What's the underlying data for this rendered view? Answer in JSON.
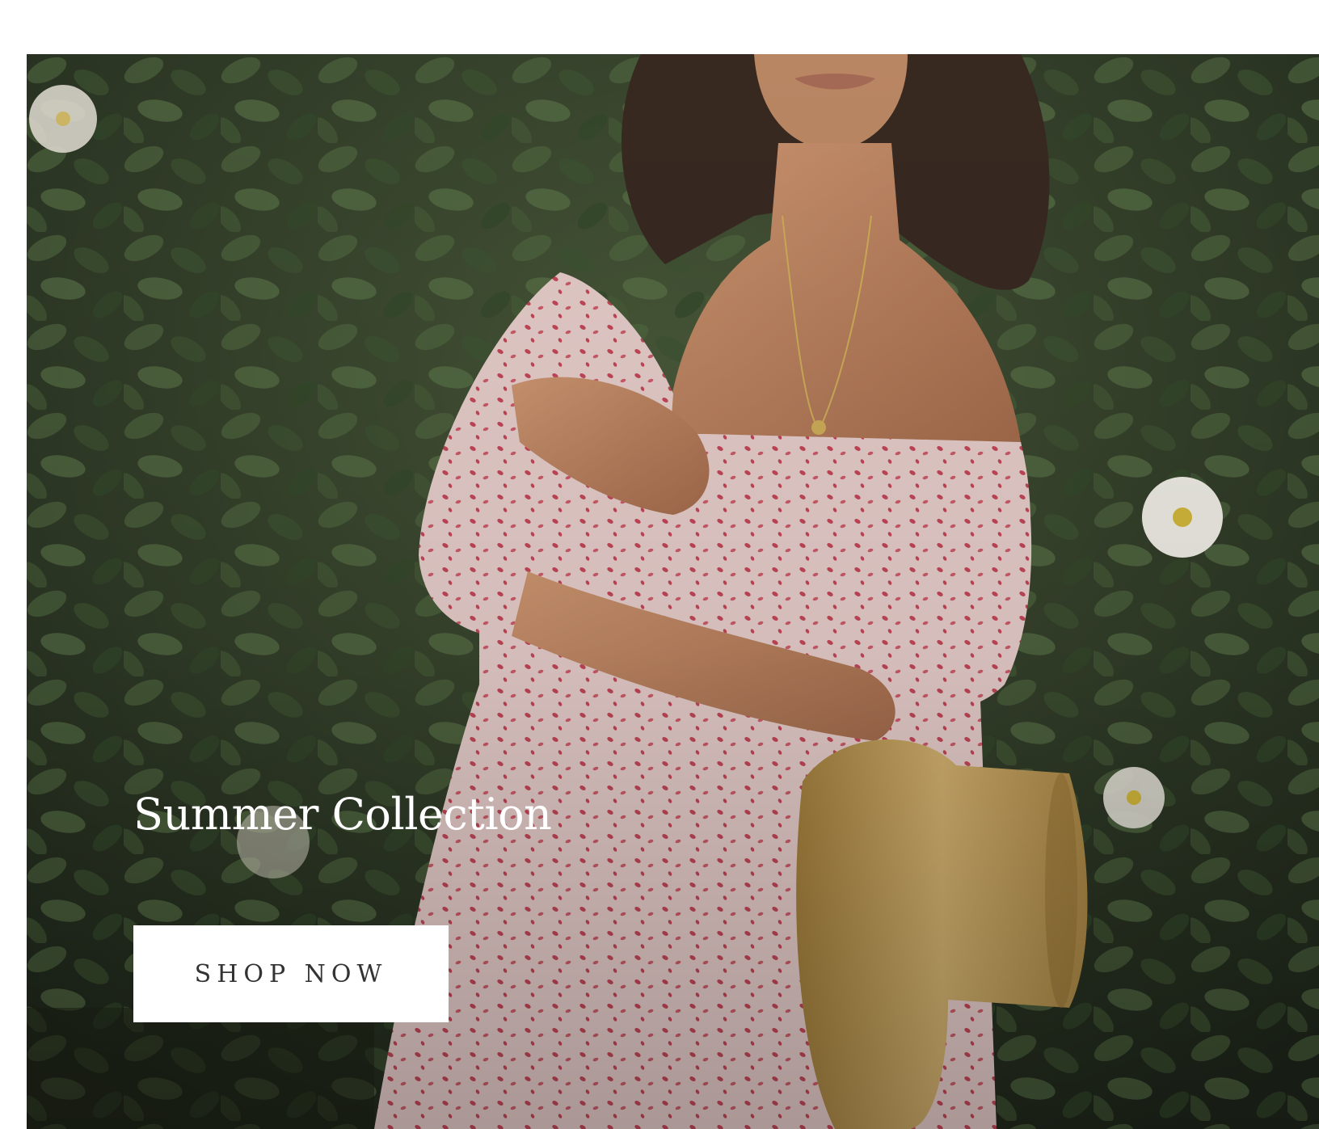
{
  "hero": {
    "title": "Summer Collection",
    "cta_label": "SHOP NOW",
    "image_description": "photo-of-woman-in-floral-dress-holding-straw-hat-in-garden"
  },
  "colors": {
    "page_background": "#ffffff",
    "text_on_image": "#ffffff",
    "button_background": "#ffffff",
    "button_text": "#333333",
    "foliage": "#3a4a2e",
    "dress": "#e9c9c6",
    "dress_print": "#c9485a",
    "skin": "#c08a66",
    "hair": "#3a2a22",
    "hat": "#c9a560",
    "flower": "#f4f2ea"
  }
}
